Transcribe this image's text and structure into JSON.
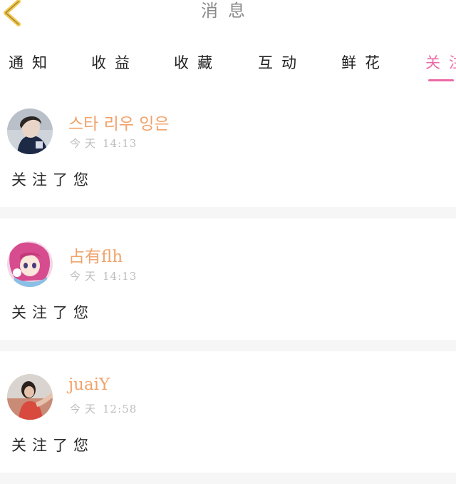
{
  "header": {
    "back_icon": "chevron-left-icon",
    "title": "消息",
    "accent_color": "#f3c84a"
  },
  "tabs": [
    {
      "label": "通知"
    },
    {
      "label": "收益"
    },
    {
      "label": "收藏"
    },
    {
      "label": "互动"
    },
    {
      "label": "鲜花"
    },
    {
      "label": "关注",
      "active": true
    }
  ],
  "active_color": "#ec6aa6",
  "notifications": [
    {
      "user": "스타 리우 잉은",
      "day": "今天",
      "time": "14:13",
      "message": "关注了您"
    },
    {
      "user": "占有flh",
      "day": "今天",
      "time": "14:13",
      "message": "关注了您"
    },
    {
      "user": "juaiY",
      "day": "今天",
      "time": "12:58",
      "message": "关注了您"
    }
  ],
  "username_color": "#f0a36c"
}
